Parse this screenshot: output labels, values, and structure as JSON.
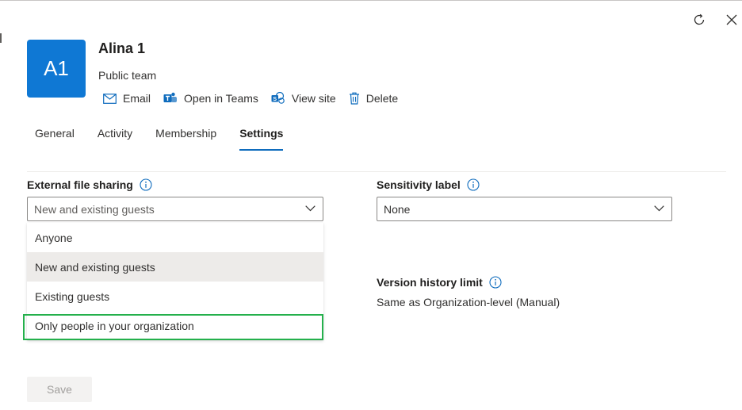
{
  "team": {
    "initials": "A1",
    "avatar_color": "#0f78d4",
    "name": "Alina 1",
    "type": "Public team"
  },
  "header_icons": [
    "refresh-icon",
    "close-icon"
  ],
  "actions": [
    {
      "label": "Email",
      "icon": "mail-icon"
    },
    {
      "label": "Open in Teams",
      "icon": "teams-icon"
    },
    {
      "label": "View site",
      "icon": "sharepoint-icon"
    },
    {
      "label": "Delete",
      "icon": "trash-icon"
    }
  ],
  "tabs": [
    {
      "label": "General",
      "active": false
    },
    {
      "label": "Activity",
      "active": false
    },
    {
      "label": "Membership",
      "active": false
    },
    {
      "label": "Settings",
      "active": true
    }
  ],
  "external_sharing": {
    "label": "External file sharing",
    "value": "New and existing guests",
    "options": [
      "Anyone",
      "New and existing guests",
      "Existing guests",
      "Only people in your organization"
    ],
    "selected_index": 1,
    "highlighted_index": 3,
    "highlight_color": "#24b04c"
  },
  "sensitivity": {
    "label": "Sensitivity label",
    "value": "None"
  },
  "version_history": {
    "label": "Version history limit",
    "value": "Same as Organization-level (Manual)"
  },
  "save_label": "Save",
  "accent_color": "#0f6cbd"
}
